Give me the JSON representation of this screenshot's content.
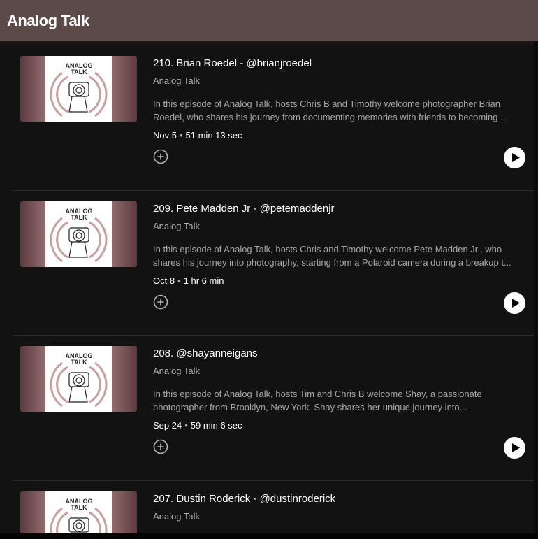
{
  "header": {
    "title": "Analog Talk"
  },
  "thumbnail_text": [
    "ANALOG",
    "TALK"
  ],
  "episodes": [
    {
      "title": "210. Brian Roedel - @brianjroedel",
      "show": "Analog Talk",
      "desc_line1": "In this episode of Analog Talk, hosts Chris B and Timothy welcome photographer Brian",
      "desc_line2": "Roedel, who shares his journey from documenting memories with friends to becoming ...",
      "date": "Nov 5",
      "separator": "•",
      "duration": "51 min 13 sec"
    },
    {
      "title": "209. Pete Madden Jr - @petemaddenjr",
      "show": "Analog Talk",
      "desc_line1": "In this episode of Analog Talk, hosts Chris and Timothy welcome Pete Madden Jr., who",
      "desc_line2": "shares his journey into photography, starting from a Polaroid camera during a breakup t...",
      "date": "Oct 8",
      "separator": "•",
      "duration": "1 hr 6 min"
    },
    {
      "title": "208. @shayanneigans",
      "show": "Analog Talk",
      "desc_line1": "In this episode of Analog Talk, hosts Tim and Chris B welcome Shay, a passionate",
      "desc_line2": "photographer from Brooklyn, New York. Shay shares her unique journey into...",
      "date": "Sep 24",
      "separator": "•",
      "duration": "59 min 6 sec"
    },
    {
      "title": "207. Dustin Roderick - @dustinroderick",
      "show": "Analog Talk"
    }
  ],
  "colors": {
    "header_bg": "#5b4a47",
    "page_bg": "#121212",
    "thumb_accent": "#b58d8e"
  },
  "icons": {
    "add": "plus-circle-icon",
    "play": "play-icon"
  }
}
